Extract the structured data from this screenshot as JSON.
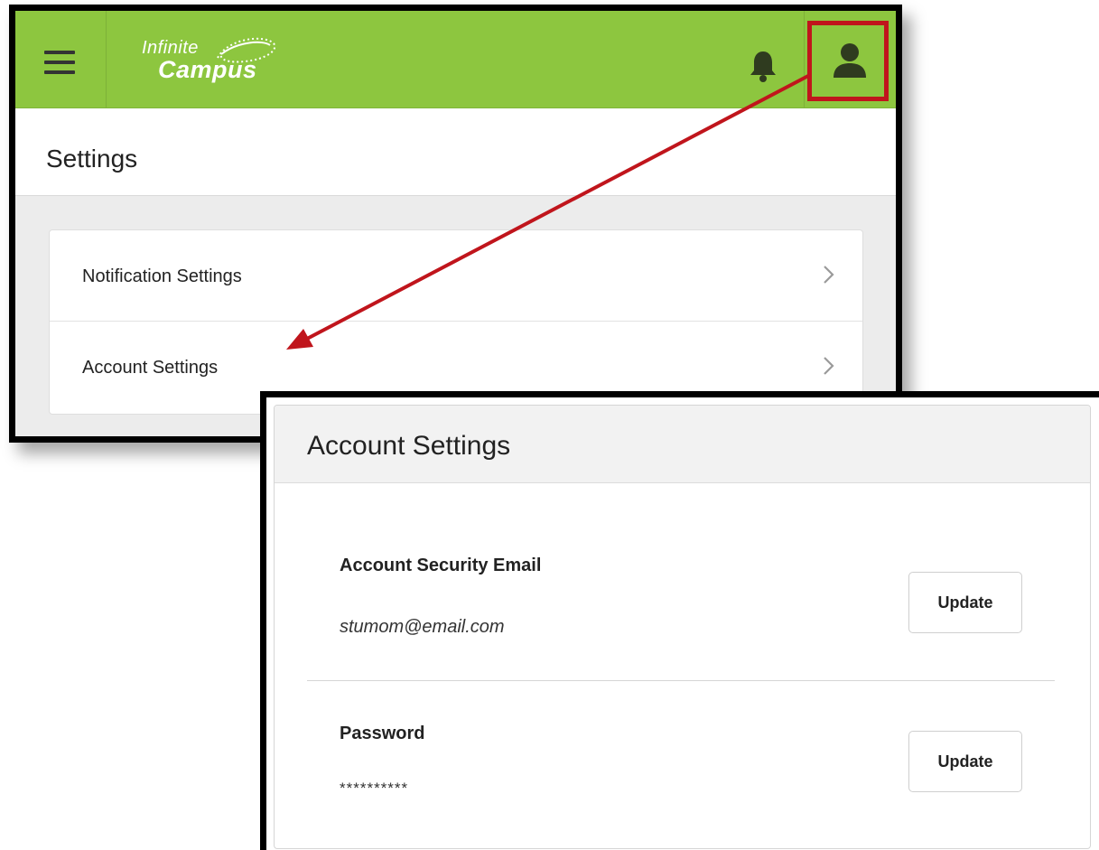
{
  "settings_window": {
    "brand": {
      "line1": "Infinite",
      "line2": "Campus"
    },
    "topbar_color": "#8dc63f",
    "icons": {
      "menu": "hamburger-menu-icon",
      "notifications": "bell-icon",
      "user": "user-icon"
    },
    "page_title": "Settings",
    "items": [
      {
        "label": "Notification Settings"
      },
      {
        "label": "Account Settings"
      }
    ]
  },
  "annotation": {
    "color": "#c0151c"
  },
  "account_settings": {
    "title": "Account Settings",
    "rows": [
      {
        "label": "Account Security Email",
        "value": "stumom@email.com",
        "button": "Update"
      },
      {
        "label": "Password",
        "value": "**********",
        "button": "Update"
      }
    ]
  }
}
